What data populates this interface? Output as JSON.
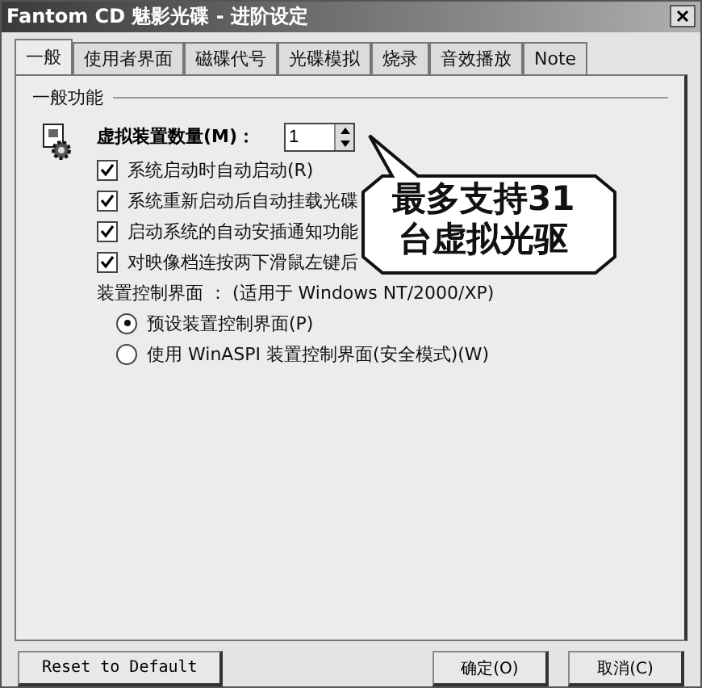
{
  "window": {
    "title": "Fantom CD 魅影光碟 - 进阶设定"
  },
  "tabs": [
    {
      "label": "一般",
      "selected": true
    },
    {
      "label": "使用者界面",
      "selected": false
    },
    {
      "label": "磁碟代号",
      "selected": false
    },
    {
      "label": "光碟模拟",
      "selected": false
    },
    {
      "label": "烧录",
      "selected": false
    },
    {
      "label": "音效播放",
      "selected": false
    },
    {
      "label": "Note",
      "selected": false
    }
  ],
  "group": {
    "title": "一般功能",
    "device_count": {
      "label": "虚拟装置数量(M)：",
      "value": "1"
    },
    "checkboxes": [
      {
        "label": "系统启动时自动启动(R)",
        "checked": true
      },
      {
        "label": "系统重新启动后自动挂载光碟",
        "checked": true
      },
      {
        "label": "启动系统的自动安插通知功能",
        "checked": true
      },
      {
        "label": "对映像档连按两下滑鼠左键后",
        "checked": true
      }
    ],
    "interface_label": "装置控制界面 ： (适用于 Windows NT/2000/XP)",
    "radios": [
      {
        "label": "预设装置控制界面(P)",
        "selected": true
      },
      {
        "label": "使用 WinASPI 装置控制界面(安全模式)(W)",
        "selected": false
      }
    ]
  },
  "callout": {
    "lines": [
      "最多支持31",
      "台虚拟光驱"
    ]
  },
  "buttons": {
    "reset": "Reset to Default",
    "ok": "确定(O)",
    "cancel": "取消(C)"
  }
}
